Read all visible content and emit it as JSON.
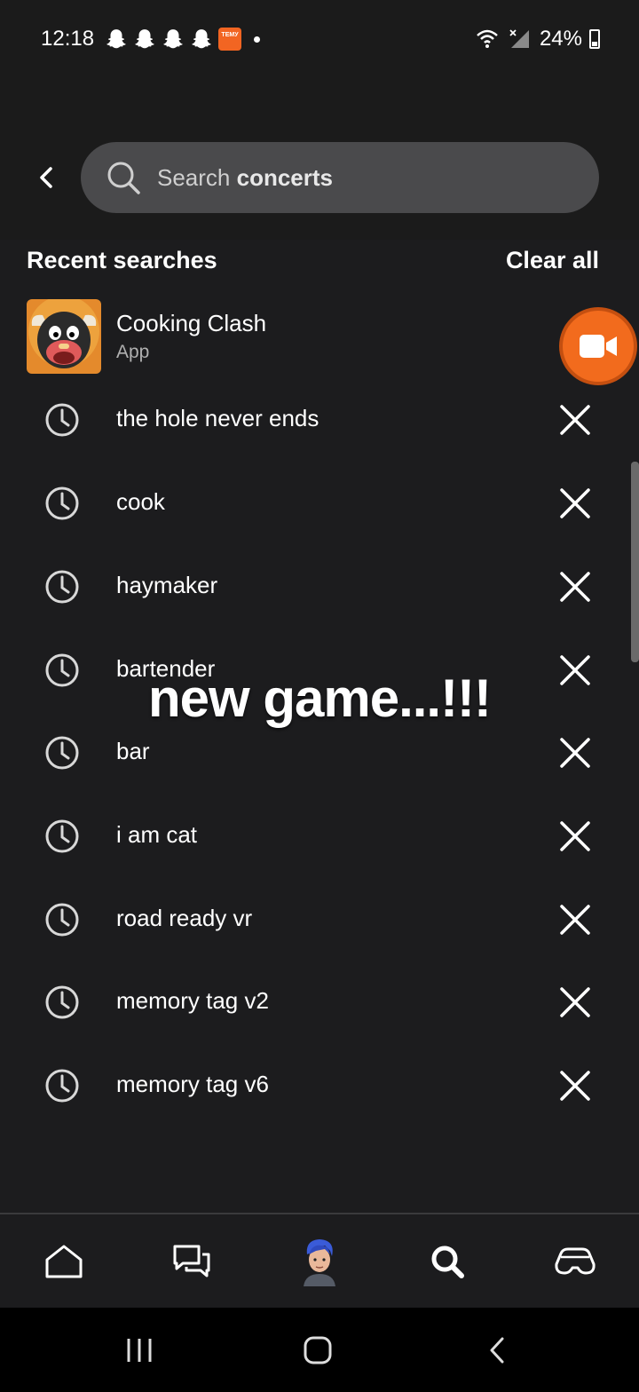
{
  "status": {
    "time": "12:18",
    "battery": "24%",
    "temu_label": "ТЕМУ",
    "icons": [
      "snapchat-icon",
      "snapchat-icon",
      "snapchat-icon",
      "snapchat-icon",
      "temu-icon",
      "notification-dot",
      "wifi-icon",
      "signal-icon",
      "battery-icon"
    ]
  },
  "search": {
    "placeholder_prefix": "Search",
    "placeholder_term": "concerts"
  },
  "recent": {
    "title": "Recent searches",
    "clear_label": "Clear all",
    "app": {
      "name": "Cooking Clash",
      "type": "App"
    },
    "items": [
      "the hole never ends",
      "cook",
      "haymaker",
      "bartender",
      "bar",
      "i am cat",
      "road ready vr",
      "memory tag v2",
      "memory tag v6"
    ]
  },
  "overlay": {
    "caption": "new game...!!!"
  },
  "tabs": [
    "home-icon",
    "chat-icon",
    "avatar",
    "search-icon",
    "headset-icon"
  ],
  "colors": {
    "background": "#1c1c1e",
    "search_bg": "#4a4a4c",
    "record": "#f26b1d"
  }
}
